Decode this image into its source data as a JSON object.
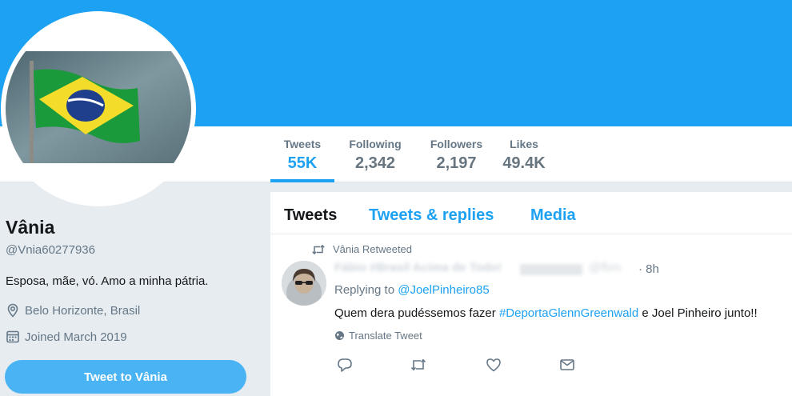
{
  "colors": {
    "accent": "#1da1f2",
    "banner": "#1da1f2",
    "button": "#4ab3f4"
  },
  "profile": {
    "name": "Vânia",
    "handle": "@Vnia60277936",
    "bio": "Esposa, mãe, vó. Amo a minha pátria.",
    "location": "Belo Horizonte, Brasil",
    "joined": "Joined March 2019",
    "tweet_to_label": "Tweet to Vânia"
  },
  "stats": {
    "tweets_label": "Tweets",
    "tweets_value": "55K",
    "following_label": "Following",
    "following_value": "2,342",
    "followers_label": "Followers",
    "followers_value": "2,197",
    "likes_label": "Likes",
    "likes_value": "49.4K"
  },
  "tabs": {
    "tweets": "Tweets",
    "replies": "Tweets & replies",
    "media": "Media"
  },
  "tweet": {
    "context": "Vânia Retweeted",
    "author_name": "Fábio #Brasil Acima de Todo!",
    "author_handle": "@fbm",
    "time": "· 8h",
    "replying_prefix": "Replying to ",
    "replying_to": "@JoelPinheiro85",
    "text_before": "Quem dera pudéssemos fazer ",
    "hashtag": "#DeportaGlennGreenwald",
    "text_after": " e Joel Pinheiro junto!!",
    "translate": "Translate Tweet"
  },
  "icons": {
    "location": "location-pin-icon",
    "calendar": "calendar-icon",
    "retweet": "retweet-icon",
    "globe": "globe-icon",
    "reply": "reply-icon",
    "like": "heart-icon",
    "dm": "envelope-icon"
  }
}
